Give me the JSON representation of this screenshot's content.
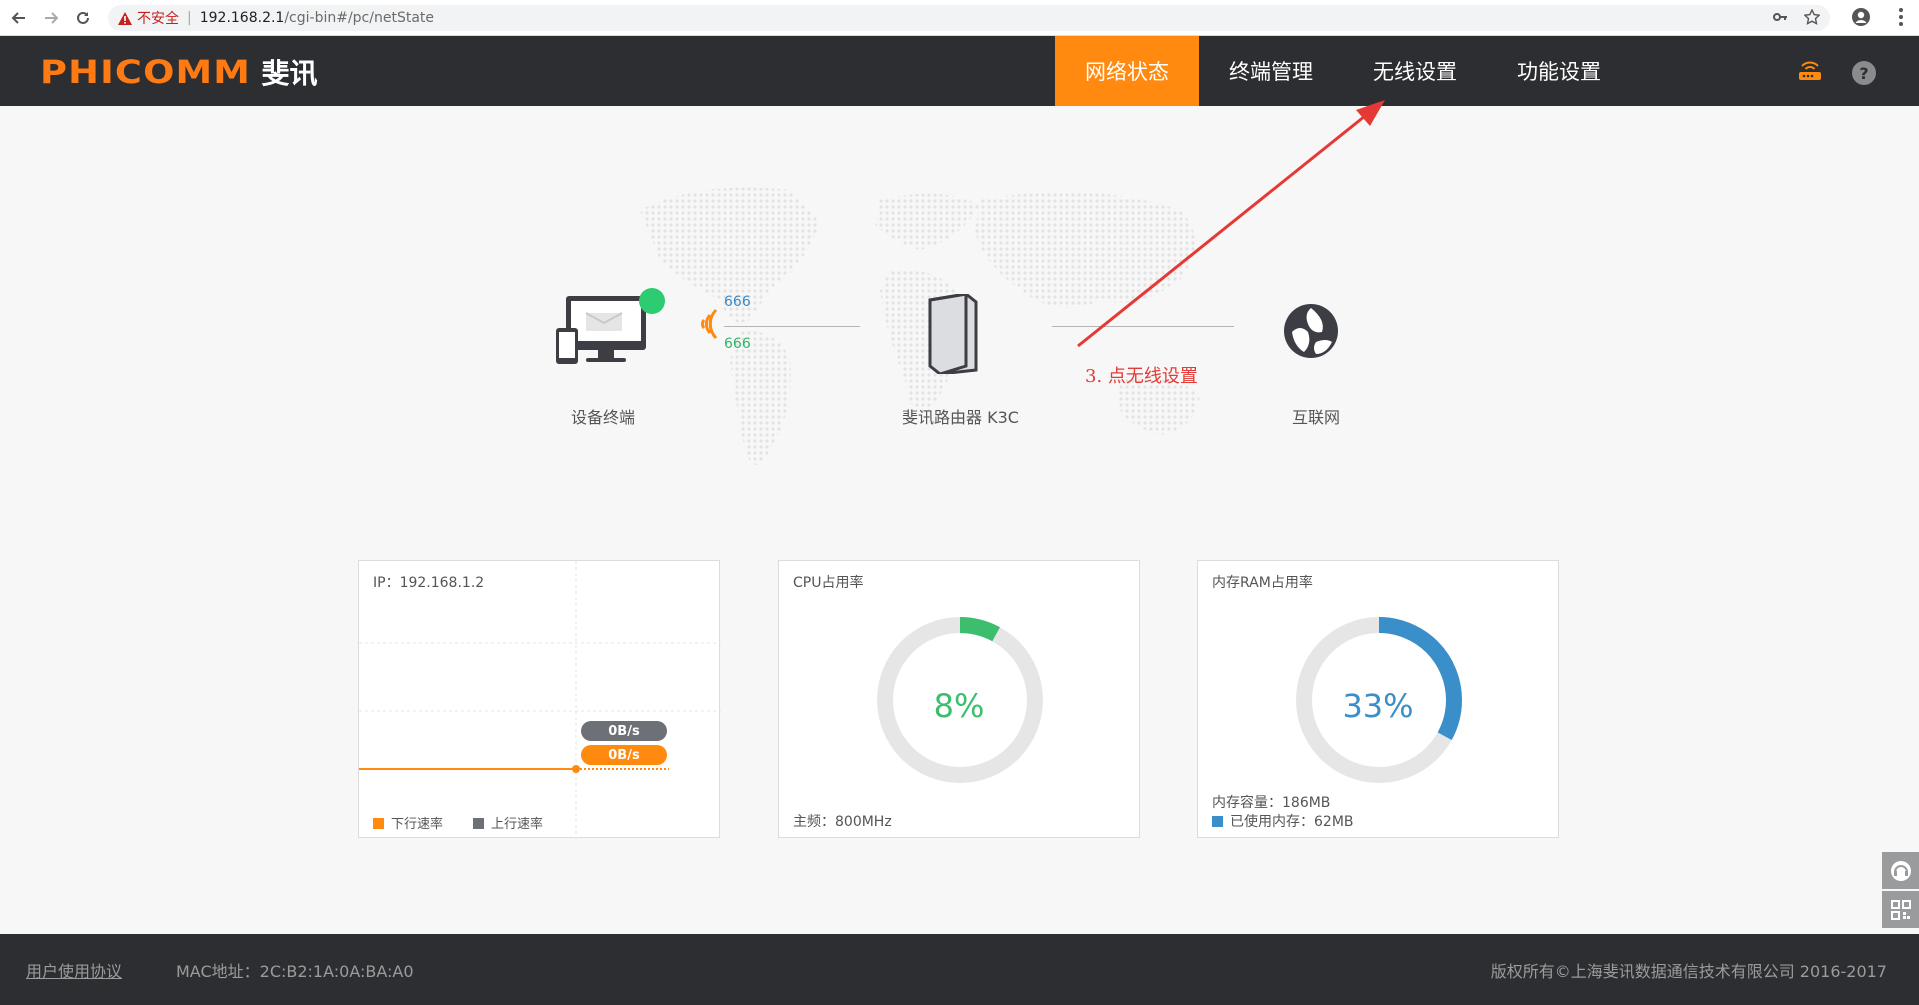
{
  "browser": {
    "security_warning": "不安全",
    "url_host": "192.168.2.1",
    "url_path": "/cgi-bin#/pc/netState"
  },
  "header": {
    "logo_en": "PHICOMM",
    "logo_cn": "斐讯",
    "nav": [
      {
        "label": "网络状态",
        "active": true
      },
      {
        "label": "终端管理",
        "active": false
      },
      {
        "label": "无线设置",
        "active": false
      },
      {
        "label": "功能设置",
        "active": false
      }
    ],
    "accent_color": "#ff8a0f"
  },
  "topology": {
    "device_label": "设备终端",
    "router_label": "斐讯路由器 K3C",
    "internet_label": "互联网",
    "up_rate": "666",
    "down_rate": "666"
  },
  "annotation": "3. 点无线设置",
  "cards": {
    "traffic": {
      "ip": "IP：192.168.1.2",
      "upload_pill": "0B/s",
      "download_pill": "0B/s",
      "legend_down": "下行速率",
      "legend_up": "上行速率"
    },
    "cpu": {
      "title": "CPU占用率",
      "percent_label": "8%",
      "usage_fraction": 0.08,
      "freq": "主频：800MHz",
      "color": "#3dbd6e"
    },
    "ram": {
      "title": "内存RAM占用率",
      "percent_label": "33%",
      "usage_fraction": 0.33,
      "capacity": "内存容量：186MB",
      "used": "已使用内存：62MB",
      "color": "#3a8ec9"
    }
  },
  "footer": {
    "agreement": "用户使用协议",
    "mac": "MAC地址：2C:B2:1A:0A:BA:A0",
    "copyright": "版权所有©上海斐讯数据通信技术有限公司 2016-2017"
  }
}
